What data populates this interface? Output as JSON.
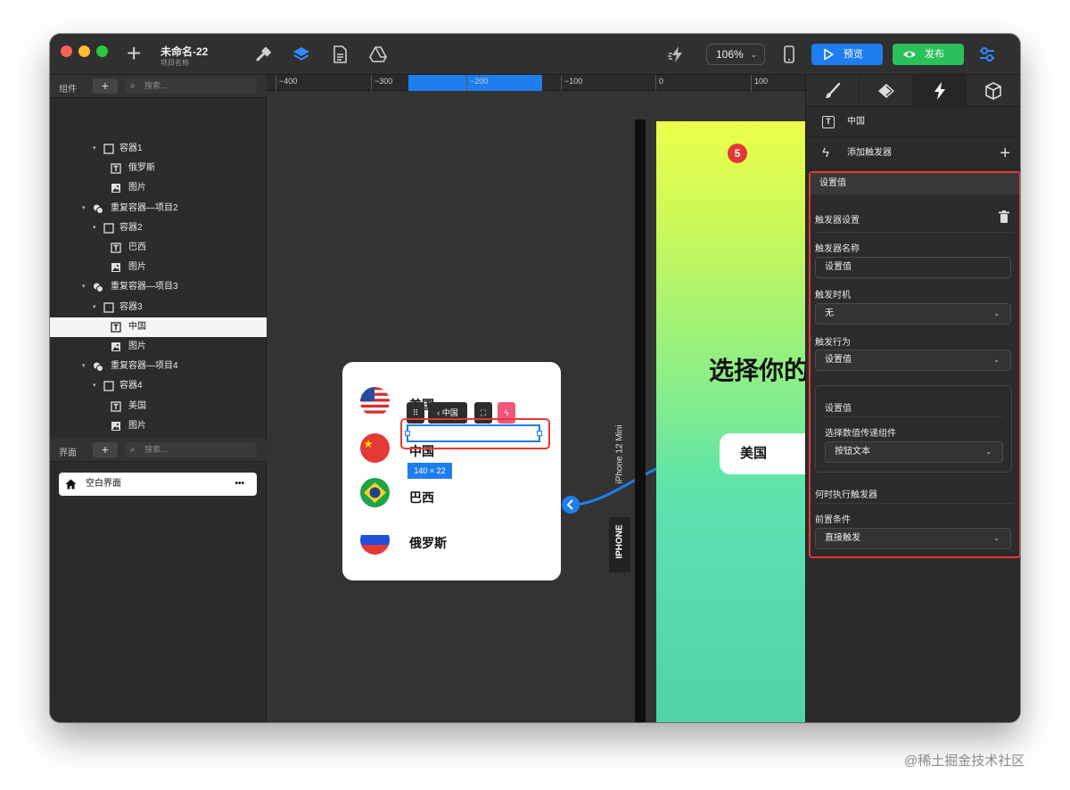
{
  "window": {
    "title": "未命名-22",
    "subtitle": "项目名称"
  },
  "toolbar": {
    "zoom": "106%",
    "preview_label": "预览",
    "publish_label": "发布"
  },
  "components_panel": {
    "label": "组件",
    "search_placeholder": "搜索...",
    "tree": [
      {
        "label": "容器1",
        "type": "container",
        "level": 1
      },
      {
        "label": "俄罗斯",
        "type": "text",
        "level": 2
      },
      {
        "label": "图片",
        "type": "image",
        "level": 2
      },
      {
        "label": "重复容器—项目2",
        "type": "repeat",
        "level": 0
      },
      {
        "label": "容器2",
        "type": "container",
        "level": 1
      },
      {
        "label": "巴西",
        "type": "text",
        "level": 2
      },
      {
        "label": "图片",
        "type": "image",
        "level": 2
      },
      {
        "label": "重复容器—项目3",
        "type": "repeat",
        "level": 0
      },
      {
        "label": "容器3",
        "type": "container",
        "level": 1
      },
      {
        "label": "中国",
        "type": "text",
        "level": 2,
        "selected": true
      },
      {
        "label": "图片",
        "type": "image",
        "level": 2
      },
      {
        "label": "重复容器—项目4",
        "type": "repeat",
        "level": 0
      },
      {
        "label": "容器4",
        "type": "container",
        "level": 1
      },
      {
        "label": "美国",
        "type": "text",
        "level": 2
      },
      {
        "label": "图片",
        "type": "image",
        "level": 2
      }
    ]
  },
  "screens_panel": {
    "label": "界面",
    "search_placeholder": "搜索...",
    "screen_name": "空白界面",
    "more": "•••"
  },
  "ruler": {
    "ticks": [
      "−400",
      "−300",
      "−200",
      "−100",
      "0",
      "100"
    ]
  },
  "canvas": {
    "countries": [
      "美国",
      "中国",
      "巴西",
      "俄罗斯"
    ],
    "selected_text": "中国",
    "mini_toolbar_label": "中国",
    "size_tag": "140 × 22",
    "device_name": "iPhone 12 Mini",
    "device_type": "IPHONE",
    "phone_heading": "选择你的",
    "phone_button": "美国"
  },
  "inspector": {
    "element_name": "中国",
    "add_trigger_label": "添加触发器",
    "step_badge": "5",
    "section_title": "设置值",
    "trigger_settings_label": "触发器设置",
    "trigger_name_label": "触发器名称",
    "trigger_name_value": "设置值",
    "timing_label": "触发时机",
    "timing_value": "无",
    "action_label": "触发行为",
    "action_value": "设置值",
    "subbox_title": "设置值",
    "subbox_field_label": "选择数值传递组件",
    "subbox_field_value": "按钮文本",
    "when_label": "何时执行触发器",
    "precondition_label": "前置条件",
    "precondition_value": "直接触发"
  },
  "watermark": "@稀土掘金技术社区",
  "colors": {
    "accent_blue": "#1e7ef0",
    "publish_green": "#2bc15a",
    "highlight_red": "#e53935"
  }
}
